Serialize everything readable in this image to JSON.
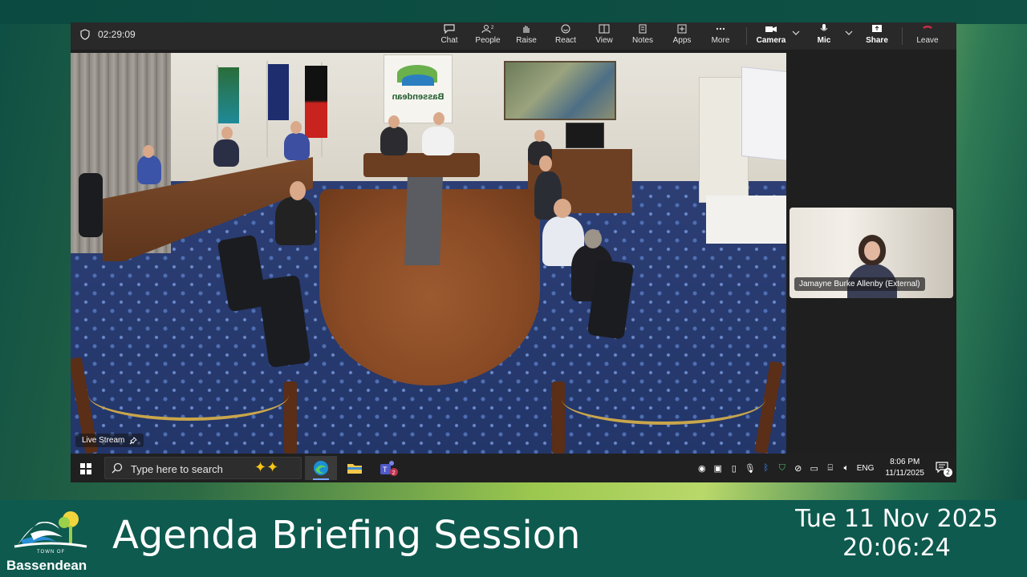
{
  "teams": {
    "call_timer": "02:29:09",
    "toolbar": {
      "chat": "Chat",
      "people": "People",
      "people_count": "2",
      "raise": "Raise",
      "react": "React",
      "view": "View",
      "notes": "Notes",
      "apps": "Apps",
      "more": "More",
      "camera": "Camera",
      "mic": "Mic",
      "share": "Share",
      "leave": "Leave"
    },
    "live_stream_label": "Live Stream",
    "participant_name": "Jamayne Burke Allenby (External)",
    "colors": {
      "leave": "#c4314b",
      "bar": "#292929"
    }
  },
  "taskbar": {
    "search_placeholder": "Type here to search",
    "language": "ENG",
    "time": "8:06 PM",
    "date": "11/11/2025",
    "notification_count": "2",
    "apps": [
      "edge-icon",
      "file-explorer-icon",
      "teams-icon"
    ],
    "teams_badge": "2"
  },
  "banner": {
    "org_small": "TOWN OF",
    "org_name": "Bassendean",
    "title": "Agenda Briefing Session",
    "date": "Tue 11 Nov 2025",
    "time": "20:06:24"
  },
  "room": {
    "sign_text": "Bassendean"
  }
}
